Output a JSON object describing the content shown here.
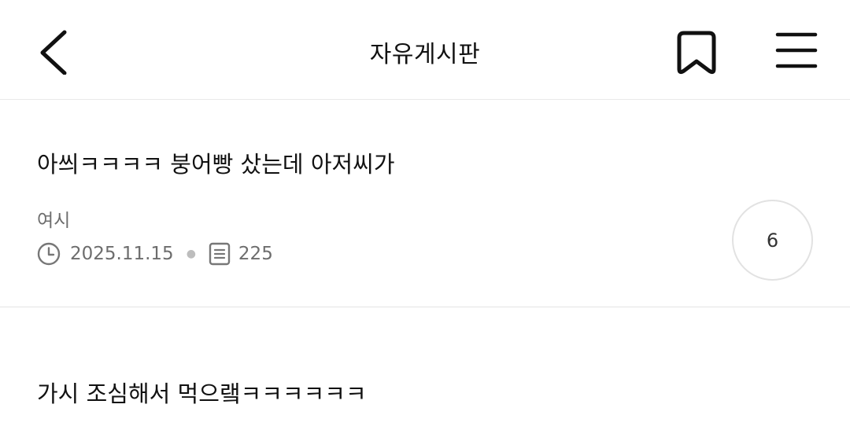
{
  "header": {
    "title": "자유게시판",
    "back_icon": "chevron-left-icon",
    "bookmark_icon": "bookmark-icon",
    "menu_icon": "hamburger-menu-icon"
  },
  "posts": [
    {
      "title": "아씌ㅋㅋㅋㅋ 붕어빵 샀는데 아저씨가",
      "author": "여시",
      "date": "2025.11.15",
      "views": "225",
      "comments": "6"
    },
    {
      "title": "가시 조심해서 먹으랰ㅋㅋㅋㅋㅋㅋ"
    }
  ],
  "colors": {
    "text": "#111111",
    "meta": "#6d6d6d",
    "divider": "#e3e3e3"
  }
}
